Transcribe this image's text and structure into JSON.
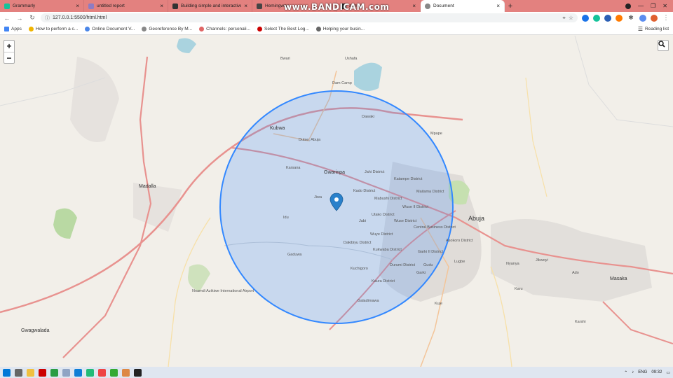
{
  "browser": {
    "tabs": [
      {
        "title": "Grammarly",
        "color": "#15c39a",
        "active": false
      },
      {
        "title": "untitled report",
        "color": "#8e7cc3",
        "active": false
      },
      {
        "title": "Building simple and interactive m",
        "color": "#333333",
        "active": false
      },
      {
        "title": "Hemingway",
        "color": "#444444",
        "active": false
      },
      {
        "title": "at main",
        "color": "#333333",
        "active": false
      },
      {
        "title": "Document",
        "color": "#888888",
        "active": true
      }
    ],
    "url": "127.0.0.1:5500/html.html",
    "bookmarks": [
      {
        "label": "Apps",
        "color": "#4285f4"
      },
      {
        "label": "How to perform a c...",
        "color": "#f0b400"
      },
      {
        "label": "Online Document V...",
        "color": "#4a86e8"
      },
      {
        "label": "Georeference By M...",
        "color": "#888888"
      },
      {
        "label": "Channels: personali...",
        "color": "#e06666"
      },
      {
        "label": "Select The Best Log...",
        "color": "#cc0000"
      },
      {
        "label": "Helping your busin...",
        "color": "#666666"
      }
    ],
    "reading_list": "Reading list"
  },
  "recording_watermark": "www.BANDICAM.com",
  "map": {
    "zoom_in": "+",
    "zoom_out": "−",
    "circle_color": "#3388ff",
    "labels": {
      "abuja": "Abuja",
      "gwarinpa": "Gwarinpa",
      "kubwa": "Kubwa",
      "madalla": "Madalla",
      "masaka": "Masaka",
      "mpape": "Mpape",
      "kado": "Kado District",
      "jahi": "Jahi District",
      "katampe": "Katampe District",
      "maitama": "Maitama District",
      "mabushi": "Mabushi District",
      "wuse2": "Wuse II District",
      "utako": "Utako District",
      "wuse": "Wuse District",
      "cbd": "Central Business District",
      "wuye": "Wuye District",
      "jabi": "Jabi",
      "daki": "Dakibiyu District",
      "asokoro": "Asokoro District",
      "garki2": "Garki II District",
      "kukwaba": "Kukwaba District",
      "durumi": "Durumi District",
      "garki": "Garki",
      "gudu": "Gudu",
      "kaura": "Kaura District",
      "galadimawa": "Galadimawa",
      "kuchigoro": "Kuchigoro",
      "gaduwa": "Gaduwa",
      "jiwa": "Jiwa",
      "idu": "Idu",
      "karsana": "Karsana",
      "dutse": "Dutse, Abuja",
      "dawaki": "Dawaki",
      "karu": "Karu",
      "nyanya": "Nyanya",
      "gwagwalada": "Gwagwalada",
      "airport": "Nnamdi Azikiwe International Airport",
      "ushafa": "Ushafa",
      "bwari": "Bwari",
      "dam": "Dam Camp",
      "kuje": "Kuje",
      "jikwoyi": "Jikwoyi",
      "ado": "Ado",
      "karshi": "Karshi",
      "lugbe": "Lugbe"
    }
  },
  "taskbar": {
    "clock": "09:32",
    "lang": "ENG"
  }
}
